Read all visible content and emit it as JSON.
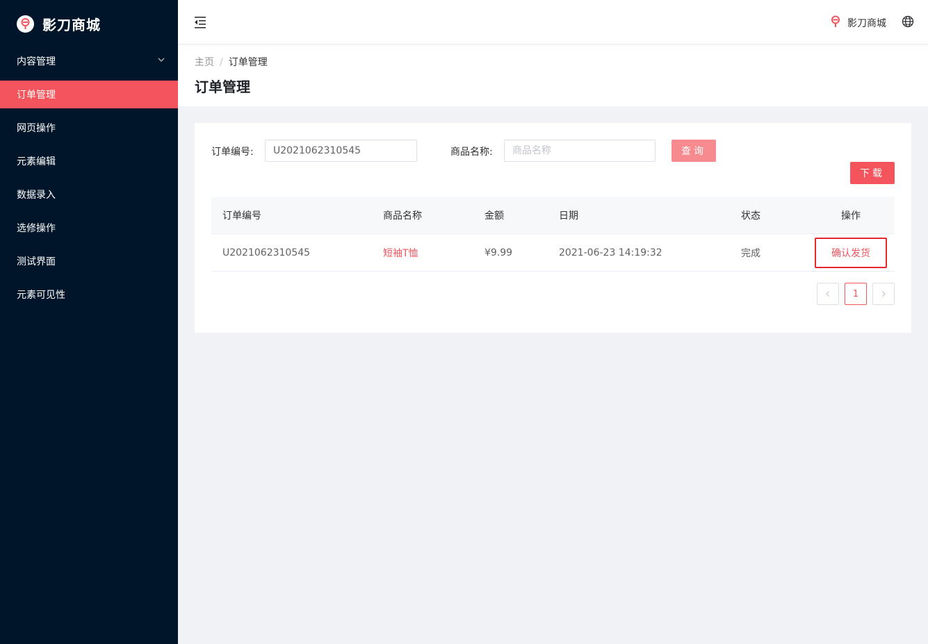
{
  "app": {
    "brand": "影刀商城"
  },
  "sidebar": {
    "items": [
      {
        "label": "内容管理",
        "has_arrow": true
      },
      {
        "label": "订单管理",
        "active": true
      },
      {
        "label": "网页操作"
      },
      {
        "label": "元素编辑"
      },
      {
        "label": "数据录入"
      },
      {
        "label": "选修操作"
      },
      {
        "label": "测试界面"
      },
      {
        "label": "元素可见性"
      }
    ]
  },
  "header": {
    "brand_text": "影刀商城",
    "icons": [
      "menu-fold-icon",
      "logo-icon",
      "globe-icon"
    ]
  },
  "breadcrumb": {
    "home": "主页",
    "separator": "/",
    "current": "订单管理"
  },
  "page": {
    "title": "订单管理"
  },
  "filters": {
    "order_no_label": "订单编号:",
    "order_no_value": "U2021062310545",
    "product_label": "商品名称:",
    "product_placeholder": "商品名称",
    "query_button": "查询",
    "download_button": "下载"
  },
  "table": {
    "columns": [
      "订单编号",
      "商品名称",
      "金额",
      "日期",
      "状态",
      "操作"
    ],
    "rows": [
      {
        "order_no": "U2021062310545",
        "product": "短袖T恤",
        "amount": "¥9.99",
        "date": "2021-06-23 14:19:32",
        "status": "完成",
        "action": "确认发货"
      }
    ]
  },
  "pagination": {
    "prev": "‹",
    "current": "1",
    "next": "›"
  },
  "colors": {
    "sidebar_bg": "#001529",
    "accent": "#f4545b",
    "accent_light": "#f78a8f",
    "highlight_border": "#e8262d"
  }
}
